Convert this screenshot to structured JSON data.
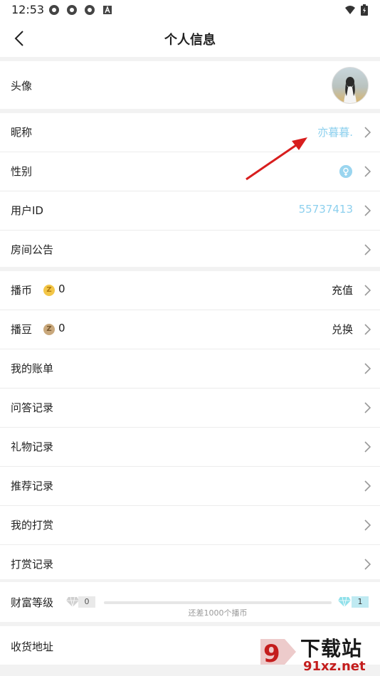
{
  "status_bar": {
    "time": "12:53",
    "icons": [
      "notification-icon",
      "notification-icon",
      "notification-icon",
      "a-icon",
      "wifi-icon",
      "battery-icon"
    ]
  },
  "header": {
    "title": "个人信息",
    "back_icon": "chevron-left-icon"
  },
  "profile": {
    "avatar_label": "头像",
    "nickname_label": "昵称",
    "nickname_value": "亦暮暮.",
    "gender_label": "性别",
    "gender_icon": "female-icon",
    "user_id_label": "用户ID",
    "user_id_value": "55737413",
    "room_notice_label": "房间公告"
  },
  "wallet": {
    "coin_label": "播币",
    "coin_value": "0",
    "coin_action": "充值",
    "bean_label": "播豆",
    "bean_value": "0",
    "bean_action": "兑换",
    "coin_badge": "Z",
    "bean_badge": "Z"
  },
  "records": {
    "items": [
      "我的账单",
      "问答记录",
      "礼物记录",
      "推荐记录",
      "我的打赏",
      "打赏记录"
    ]
  },
  "wealth": {
    "label": "财富等级",
    "current_level": "0",
    "next_level": "1",
    "progress": 0,
    "hint": "还差1000个播币"
  },
  "address": {
    "label": "收货地址"
  },
  "watermark": {
    "line1": "下载站",
    "line2": "91xz.net"
  },
  "colors": {
    "accent_blue": "#8dd0ee",
    "arrow_red": "#d81e1e"
  }
}
